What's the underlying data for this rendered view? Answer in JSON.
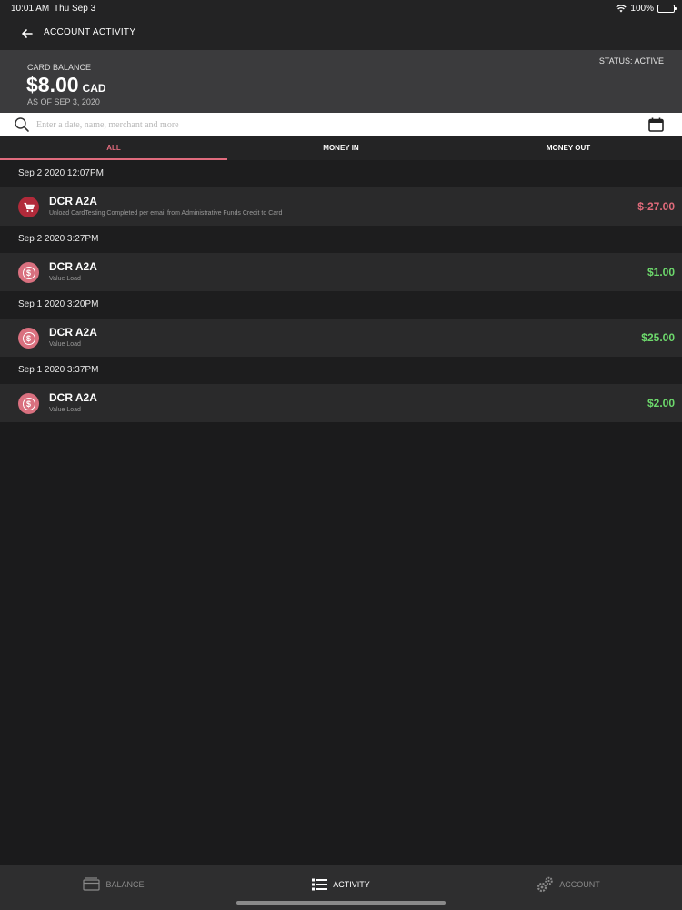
{
  "statusbar": {
    "time": "10:01 AM",
    "date": "Thu Sep 3",
    "battery": "100%",
    "icons": [
      "wifi-icon",
      "battery-icon"
    ]
  },
  "nav": {
    "title": "ACCOUNT ACTIVITY",
    "back_icon": "back-arrow-icon"
  },
  "balance": {
    "label": "CARD BALANCE",
    "amount": "$8.00",
    "currency": "CAD",
    "as_of": "AS OF SEP 3, 2020",
    "status": "STATUS: ACTIVE"
  },
  "search": {
    "placeholder": "Enter a date, name, merchant and more",
    "value": ""
  },
  "tabs": [
    {
      "label": "ALL",
      "active": true
    },
    {
      "label": "MONEY IN",
      "active": false
    },
    {
      "label": "MONEY OUT",
      "active": false
    }
  ],
  "groups": [
    {
      "date": "Sep  2 2020 12:07PM",
      "tx": {
        "name": "DCR A2A",
        "desc": "Unload CardTesting Completed per email from  Administrative Funds Credit to Card",
        "amount": "$-27.00",
        "icon": "shopping-cart-icon"
      }
    },
    {
      "date": "Sep  2 2020  3:27PM",
      "tx": {
        "name": "DCR A2A",
        "desc": "Value Load",
        "amount": "$1.00",
        "icon": "dollar-icon"
      }
    },
    {
      "date": "Sep  1 2020  3:20PM",
      "tx": {
        "name": "DCR A2A",
        "desc": "Value Load",
        "amount": "$25.00",
        "icon": "dollar-icon"
      }
    },
    {
      "date": "Sep  1 2020  3:37PM",
      "tx": {
        "name": "DCR A2A",
        "desc": "Value Load",
        "amount": "$2.00",
        "icon": "dollar-icon"
      }
    }
  ],
  "bottom_nav": [
    {
      "label": "BALANCE",
      "icon": "card-icon",
      "active": false
    },
    {
      "label": "ACTIVITY",
      "icon": "list-icon",
      "active": true
    },
    {
      "label": "ACCOUNT",
      "icon": "gears-icon",
      "active": false
    }
  ],
  "colors": {
    "accent": "#e06b7d",
    "positive": "#6dd96c",
    "negative": "#e16b7b",
    "background": "#1b1b1c"
  }
}
